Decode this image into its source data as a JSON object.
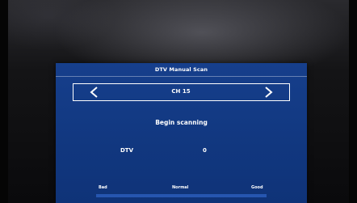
{
  "menu": {
    "title": "DTV Manual Scan",
    "channel": "CH 15",
    "status": "Begin scanning",
    "dtv_label": "DTV",
    "dtv_value": "0"
  },
  "signal": {
    "bad_label": "Bad",
    "normal_label": "Normal",
    "good_label": "Good"
  },
  "icons": {
    "prev": "chevron-left-icon",
    "next": "chevron-right-icon"
  },
  "colors": {
    "panel": "#11377f",
    "text": "#ffffff"
  }
}
